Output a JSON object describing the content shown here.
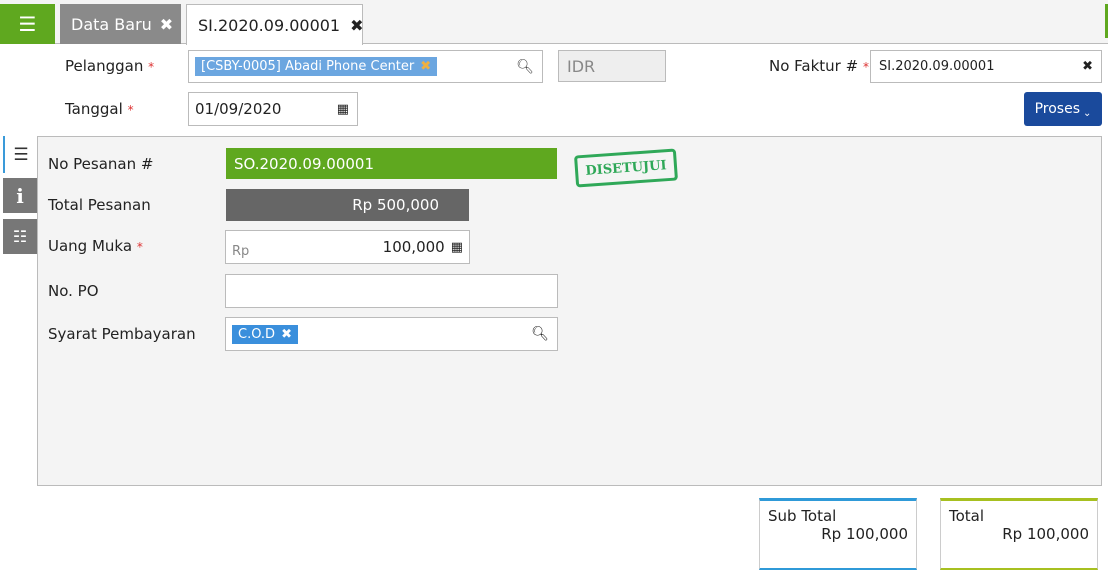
{
  "tabs": [
    {
      "label": "Data Baru"
    },
    {
      "label": "SI.2020.09.00001"
    }
  ],
  "header": {
    "pelanggan_label": "Pelanggan",
    "pelanggan_value": "[CSBY-0005] Abadi Phone Center",
    "currency": "IDR",
    "tanggal_label": "Tanggal",
    "tanggal_value": "01/09/2020",
    "no_faktur_label": "No Faktur #",
    "no_faktur_value": "SI.2020.09.00001",
    "proses_label": "Proses",
    "required_mark": "*"
  },
  "form": {
    "no_pesanan_label": "No Pesanan #",
    "no_pesanan_value": "SO.2020.09.00001",
    "status_stamp": "DISETUJUI",
    "total_pesanan_label": "Total Pesanan",
    "total_pesanan_value": "Rp 500,000",
    "uang_muka_label": "Uang Muka",
    "uang_muka_prefix": "Rp",
    "uang_muka_value": "100,000",
    "no_po_label": "No. PO",
    "no_po_value": "",
    "syarat_label": "Syarat Pembayaran",
    "syarat_value": "C.O.D"
  },
  "summary": {
    "subtotal_label": "Sub Total",
    "subtotal_value": "Rp 100,000",
    "total_label": "Total",
    "total_value": "Rp 100,000"
  },
  "colors": {
    "green": "#5fa81f",
    "blue": "#1a4a9c",
    "chip": "#6ba6e0",
    "subtotal_border": "#2f9ad8",
    "total_border": "#a7c020"
  }
}
